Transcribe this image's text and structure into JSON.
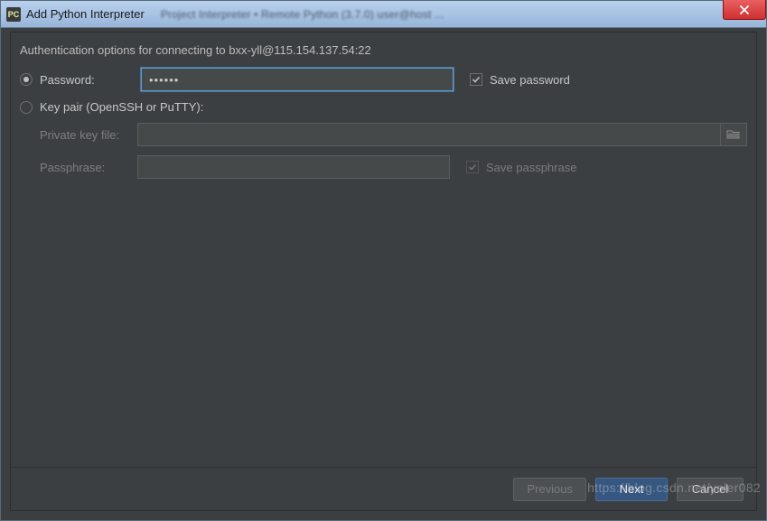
{
  "titlebar": {
    "app_icon_text": "PC",
    "title": "Add Python Interpreter",
    "blurred_rest": "Project Interpreter   •  Remote Python  (3.7.0) user@host  ..."
  },
  "auth": {
    "header": "Authentication options for connecting to bxx-yll@115.154.137.54:22",
    "password_label": "Password:",
    "password_value": "••••••",
    "save_password_label": "Save password",
    "keypair_label": "Key pair (OpenSSH or PuTTY):",
    "private_key_label": "Private key file:",
    "private_key_value": "",
    "passphrase_label": "Passphrase:",
    "passphrase_value": "",
    "save_passphrase_label": "Save passphrase"
  },
  "buttons": {
    "previous": "Previous",
    "next": "Next",
    "cancel": "Cancel"
  },
  "watermark": "https://blog.csdn.net/yeler082"
}
